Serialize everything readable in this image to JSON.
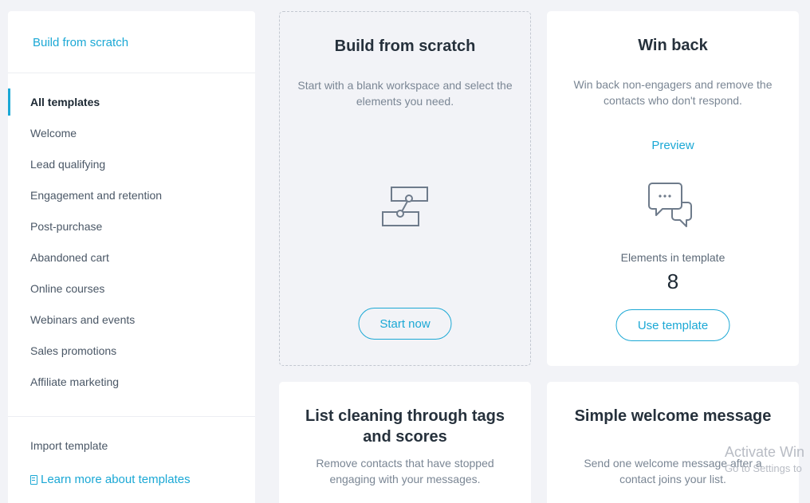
{
  "sidebar": {
    "build_from_scratch": "Build from scratch",
    "items": [
      {
        "label": "All templates"
      },
      {
        "label": "Welcome"
      },
      {
        "label": "Lead qualifying"
      },
      {
        "label": "Engagement and retention"
      },
      {
        "label": "Post-purchase"
      },
      {
        "label": "Abandoned cart"
      },
      {
        "label": "Online courses"
      },
      {
        "label": "Webinars and events"
      },
      {
        "label": "Sales promotions"
      },
      {
        "label": "Affiliate marketing"
      }
    ],
    "import_template": "Import template",
    "learn_more": "Learn more about templates"
  },
  "cards": {
    "scratch": {
      "title": "Build from scratch",
      "description": "Start with a blank workspace and select the elements you need.",
      "button": "Start now",
      "icon": "workflow-icon"
    },
    "winback": {
      "title": "Win back",
      "description": "Win back non-engagers and remove the contacts who don't respond.",
      "preview": "Preview",
      "icon": "chat-bubbles-icon",
      "elements_label": "Elements in template",
      "elements_count": "8",
      "button": "Use template"
    },
    "list_cleaning": {
      "title": "List cleaning through tags and scores",
      "description": "Remove contacts that have stopped engaging with your messages."
    },
    "welcome": {
      "title": "Simple welcome message",
      "description": "Send one welcome message after a contact joins your list."
    }
  },
  "watermark": {
    "line1": "Activate Win",
    "line2": "Go to Settings to"
  },
  "colors": {
    "accent": "#1ba8d5",
    "background": "#f2f3f7",
    "card": "#ffffff"
  }
}
